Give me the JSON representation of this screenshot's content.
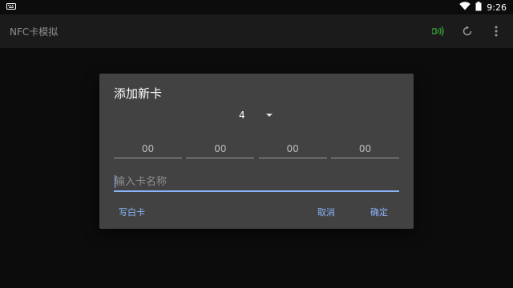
{
  "status_bar": {
    "time": "9:26",
    "icons": [
      "keyboard-icon",
      "wifi-icon",
      "battery-icon"
    ]
  },
  "app_bar": {
    "title": "NFC卡模拟",
    "actions": [
      "nfc-icon",
      "refresh-icon",
      "more-vert-icon"
    ],
    "nfc_color": "#3aa53a"
  },
  "dialog": {
    "title": "添加新卡",
    "length_value": "4",
    "hex_fields": [
      {
        "placeholder": "00"
      },
      {
        "placeholder": "00"
      },
      {
        "placeholder": "00"
      },
      {
        "placeholder": "00"
      }
    ],
    "name_placeholder": "输入卡名称",
    "buttons": {
      "write_blank": "写白卡",
      "cancel": "取消",
      "ok": "确定"
    },
    "accent_color": "#8ab4f8"
  }
}
